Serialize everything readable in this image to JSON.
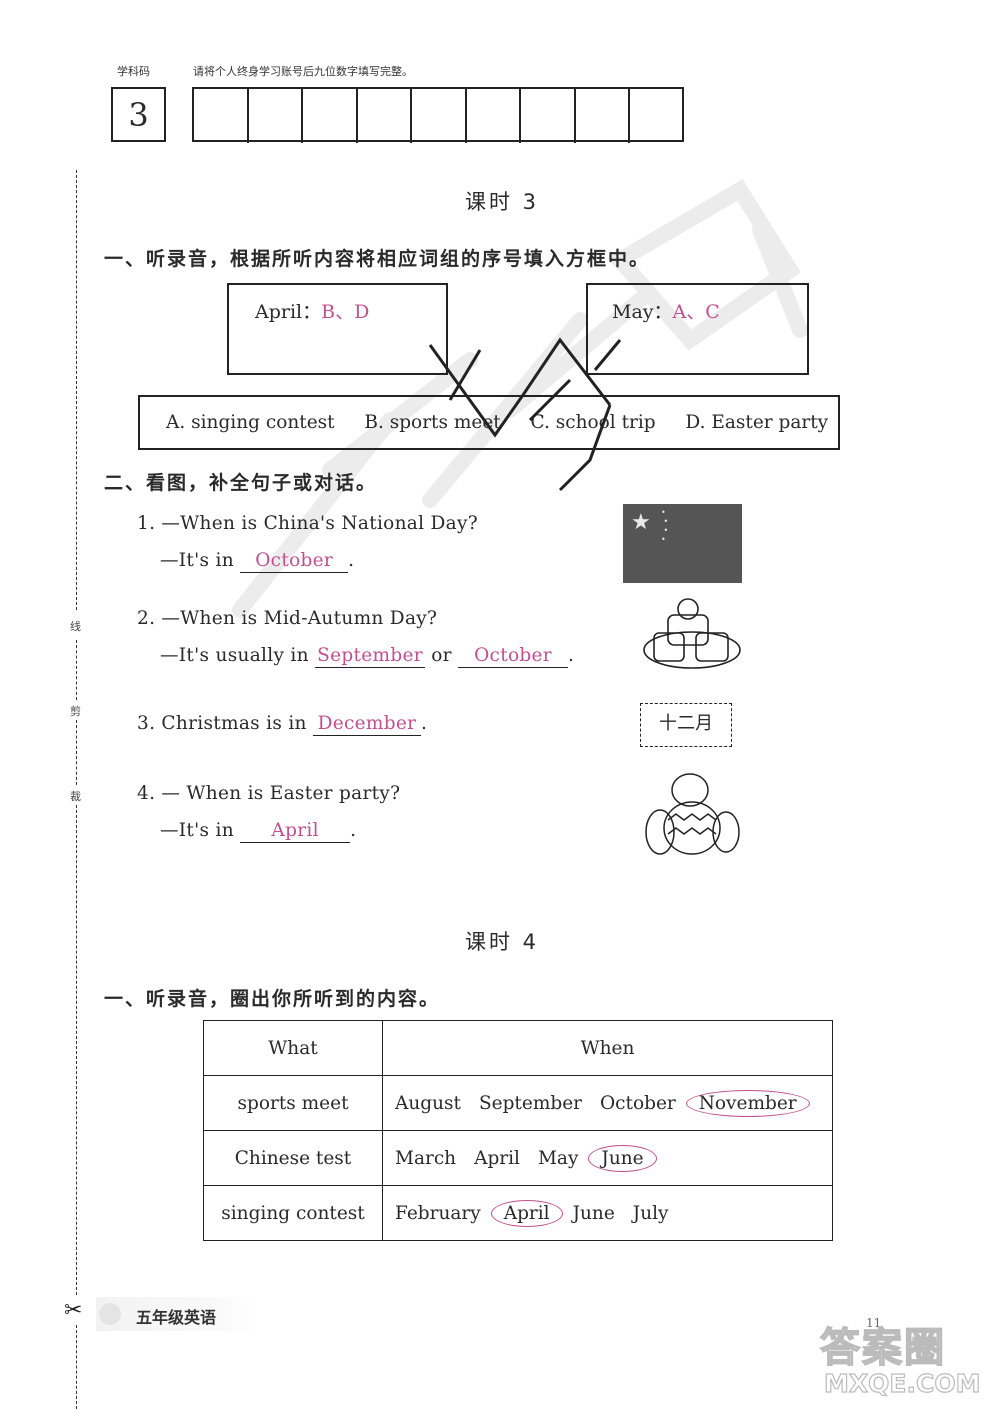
{
  "header": {
    "subject_code_label": "学科码",
    "instruction": "请将个人终身学习账号后九位数字填写完整。",
    "subject_code_value": "3",
    "account_digits": [
      "",
      "",
      "",
      "",
      "",
      "",
      "",
      "",
      ""
    ]
  },
  "margin": {
    "cut_line_chars": [
      "线",
      "剪",
      "裁"
    ],
    "scissors_icon": "✂"
  },
  "lesson3": {
    "title": "课时 3",
    "part1": {
      "heading": "一、听录音，根据所听内容将相应词组的序号填入方框中。",
      "boxes": [
        {
          "label": "April：",
          "answer": "B、D"
        },
        {
          "label": "May：",
          "answer": "A、C"
        }
      ],
      "options": [
        "A. singing contest",
        "B. sports meet",
        "C. school trip",
        "D. Easter party"
      ]
    },
    "part2": {
      "heading": "二、看图，补全句子或对话。",
      "questions": [
        {
          "q": "1. —When is China's National Day?",
          "a_prefix": "—It's in",
          "answers": [
            "October"
          ],
          "a_suffix": ".",
          "image": "china-flag"
        },
        {
          "q": "2. —When is Mid-Autumn Day?",
          "a_prefix": "—It's usually in",
          "answers": [
            "September",
            "October"
          ],
          "connector": "or",
          "a_suffix": ".",
          "image": "mooncakes"
        },
        {
          "q": "3. Christmas is in",
          "answers": [
            "December"
          ],
          "a_suffix": ".",
          "image": "calendar-card",
          "image_text": "十二月"
        },
        {
          "q": "4. — When is Easter party?",
          "a_prefix": "—It's in",
          "answers": [
            "April"
          ],
          "a_suffix": ".",
          "image": "easter-eggs"
        }
      ]
    }
  },
  "lesson4": {
    "title": "课时 4",
    "part1": {
      "heading": "一、听录音，圈出你所听到的内容。",
      "columns": [
        "What",
        "When"
      ],
      "rows": [
        {
          "what": "sports meet",
          "months": [
            "August",
            "September",
            "October",
            "November"
          ],
          "circled": "November"
        },
        {
          "what": "Chinese test",
          "months": [
            "March",
            "April",
            "May",
            "June"
          ],
          "circled": "June"
        },
        {
          "what": "singing contest",
          "months": [
            "February",
            "April",
            "June",
            "July"
          ],
          "circled": "April"
        }
      ]
    }
  },
  "footer": {
    "book_label": "五年级英语",
    "page_number": "11"
  },
  "watermarks": {
    "site_cn": "答案圈",
    "site_url": "MXQE.COM"
  },
  "colors": {
    "answer_pink": "#c0508f",
    "flag_grey": "#555555"
  }
}
